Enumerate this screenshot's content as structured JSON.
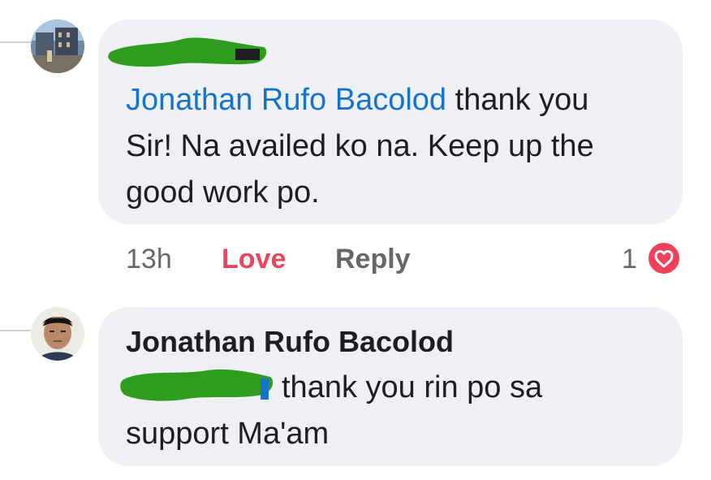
{
  "comment1": {
    "author_redacted": true,
    "mention": "Jonathan Rufo Bacolod",
    "text_line1": " thank you",
    "text_line2": "Sir! Na availed ko na. Keep up the",
    "text_line3": "good work po.",
    "time": "13h",
    "love_label": "Love",
    "reply_label": "Reply",
    "reaction_count": "1",
    "reaction_icon": "heart-icon"
  },
  "comment2": {
    "author": "Jonathan Rufo Bacolod",
    "mention_redacted": true,
    "text_line1": "thank you rin po sa",
    "text_line2": "support Ma'am"
  },
  "colors": {
    "bubble": "#eff0f4",
    "mention": "#1673c9",
    "love": "#e8465e",
    "muted": "#65676b",
    "redaction": "#2e9c1c",
    "heart": "#f0405c"
  }
}
